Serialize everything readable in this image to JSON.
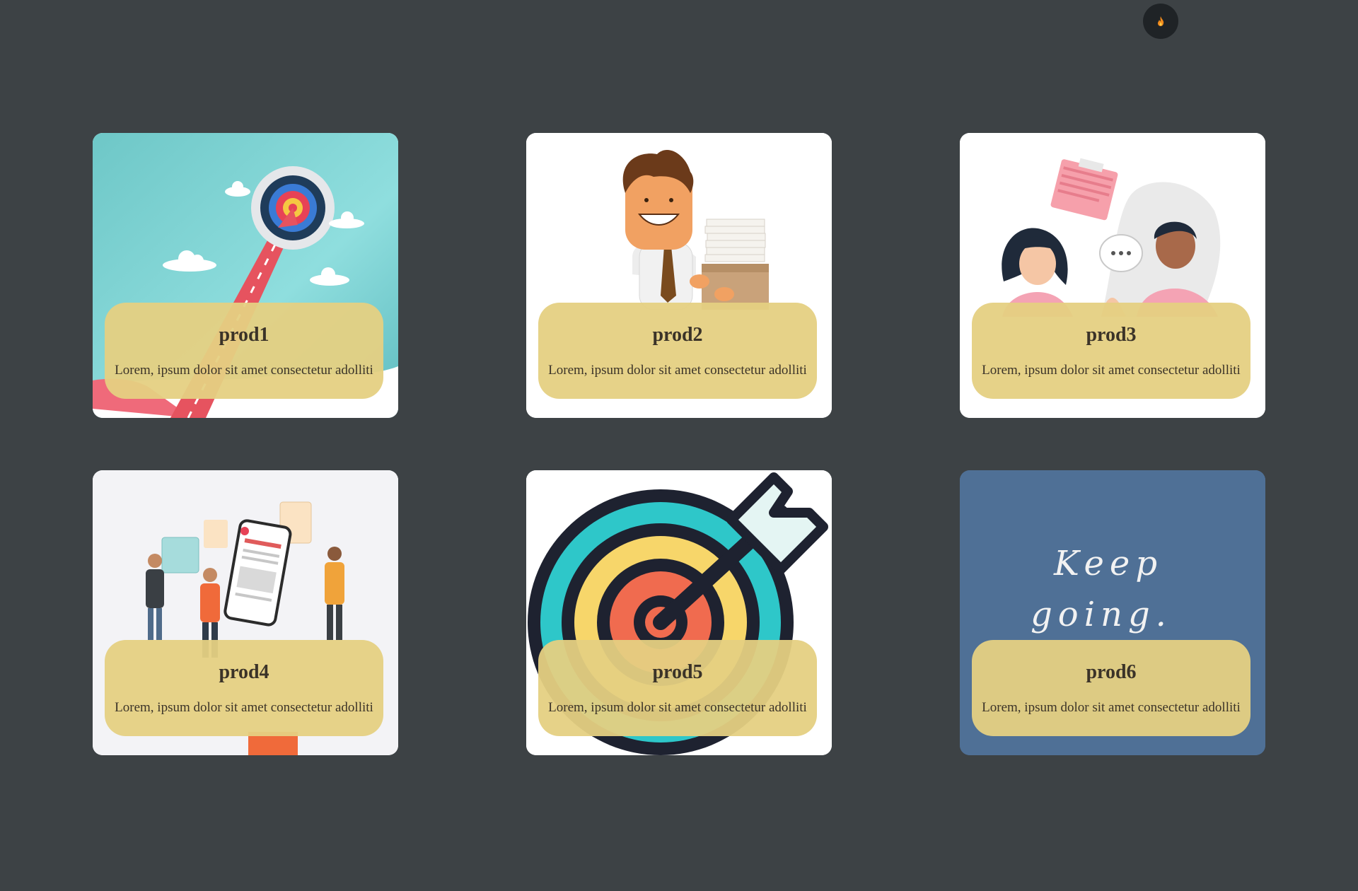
{
  "theme_toggle": {
    "icon": "flame-icon"
  },
  "cards": [
    {
      "title": "prod1",
      "description": "Lorem, ipsum dolor sit amet consectetur adolliti",
      "image": "target-arrow-road-illustration"
    },
    {
      "title": "prod2",
      "description": "Lorem, ipsum dolor sit amet consectetur adolliti",
      "image": "businessman-with-papers-illustration"
    },
    {
      "title": "prod3",
      "description": "Lorem, ipsum dolor sit amet consectetur adolliti",
      "image": "two-people-chatting-illustration"
    },
    {
      "title": "prod4",
      "description": "Lorem, ipsum dolor sit amet consectetur adolliti",
      "image": "people-with-phones-news-illustration"
    },
    {
      "title": "prod5",
      "description": "Lorem, ipsum dolor sit amet consectetur adolliti",
      "image": "dartboard-arrow-illustration"
    },
    {
      "title": "prod6",
      "description": "Lorem, ipsum dolor sit amet consectetur adolliti",
      "image": "keep-going-lettering",
      "image_text": "Keep going."
    }
  ],
  "colors": {
    "background": "#3d4245",
    "panel": "#e5d082",
    "card6_background": "#4f7096"
  }
}
